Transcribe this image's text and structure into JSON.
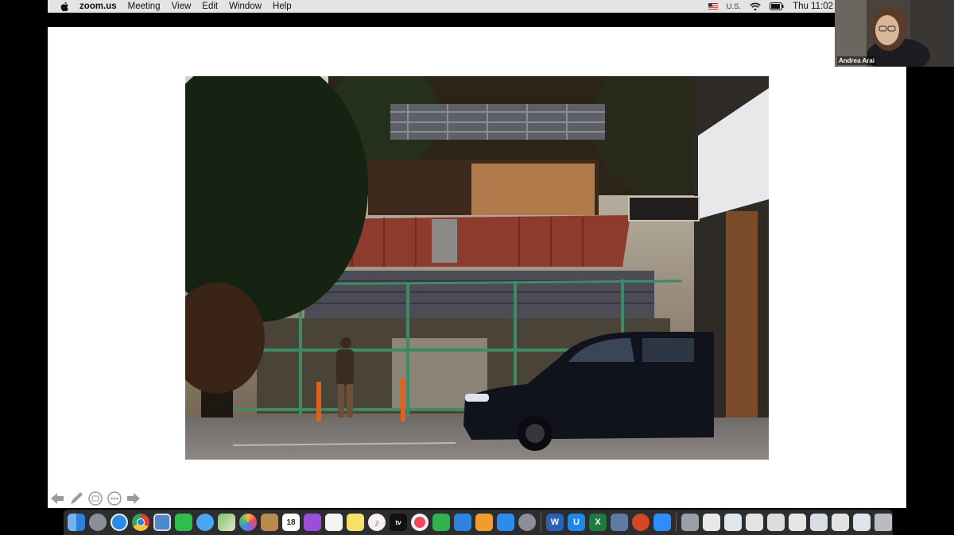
{
  "menubar": {
    "app_name": "zoom.us",
    "items": [
      "Meeting",
      "View",
      "Edit",
      "Window",
      "Help"
    ],
    "input_source": "U.S.",
    "clock": "Thu 11:02"
  },
  "participant": {
    "name": "Andrea Arai"
  },
  "slide": {
    "tools": [
      "arrow-left-icon",
      "pen-icon",
      "whiteboard-icon",
      "more-icon",
      "arrow-right-icon"
    ]
  },
  "dock": {
    "calendar_date": "18",
    "tv_label": "tv",
    "word_letter": "W",
    "excel_letter": "X",
    "u_letter": "U",
    "app_icons": [
      "finder-icon",
      "launchpad-icon",
      "safari-icon",
      "chrome-icon",
      "preview-icon",
      "facetime-icon",
      "messages-icon",
      "maps-icon",
      "photos-icon",
      "notes-icon",
      "calendar-icon",
      "podcasts-icon",
      "reminders-icon",
      "stickies-icon",
      "music-icon",
      "appletv-icon",
      "news-icon",
      "numbers-icon",
      "keynote-icon",
      "pages-icon",
      "appstore-icon",
      "system-preferences-icon",
      "word-icon",
      "unicheck-icon",
      "excel-icon",
      "capture-icon",
      "powerpoint-icon",
      "zoom-icon"
    ]
  },
  "colors": {
    "menubar_bg": "#e6e3e6",
    "dock_bg": "#2d2d30",
    "slide_bg": "#ffffff"
  }
}
